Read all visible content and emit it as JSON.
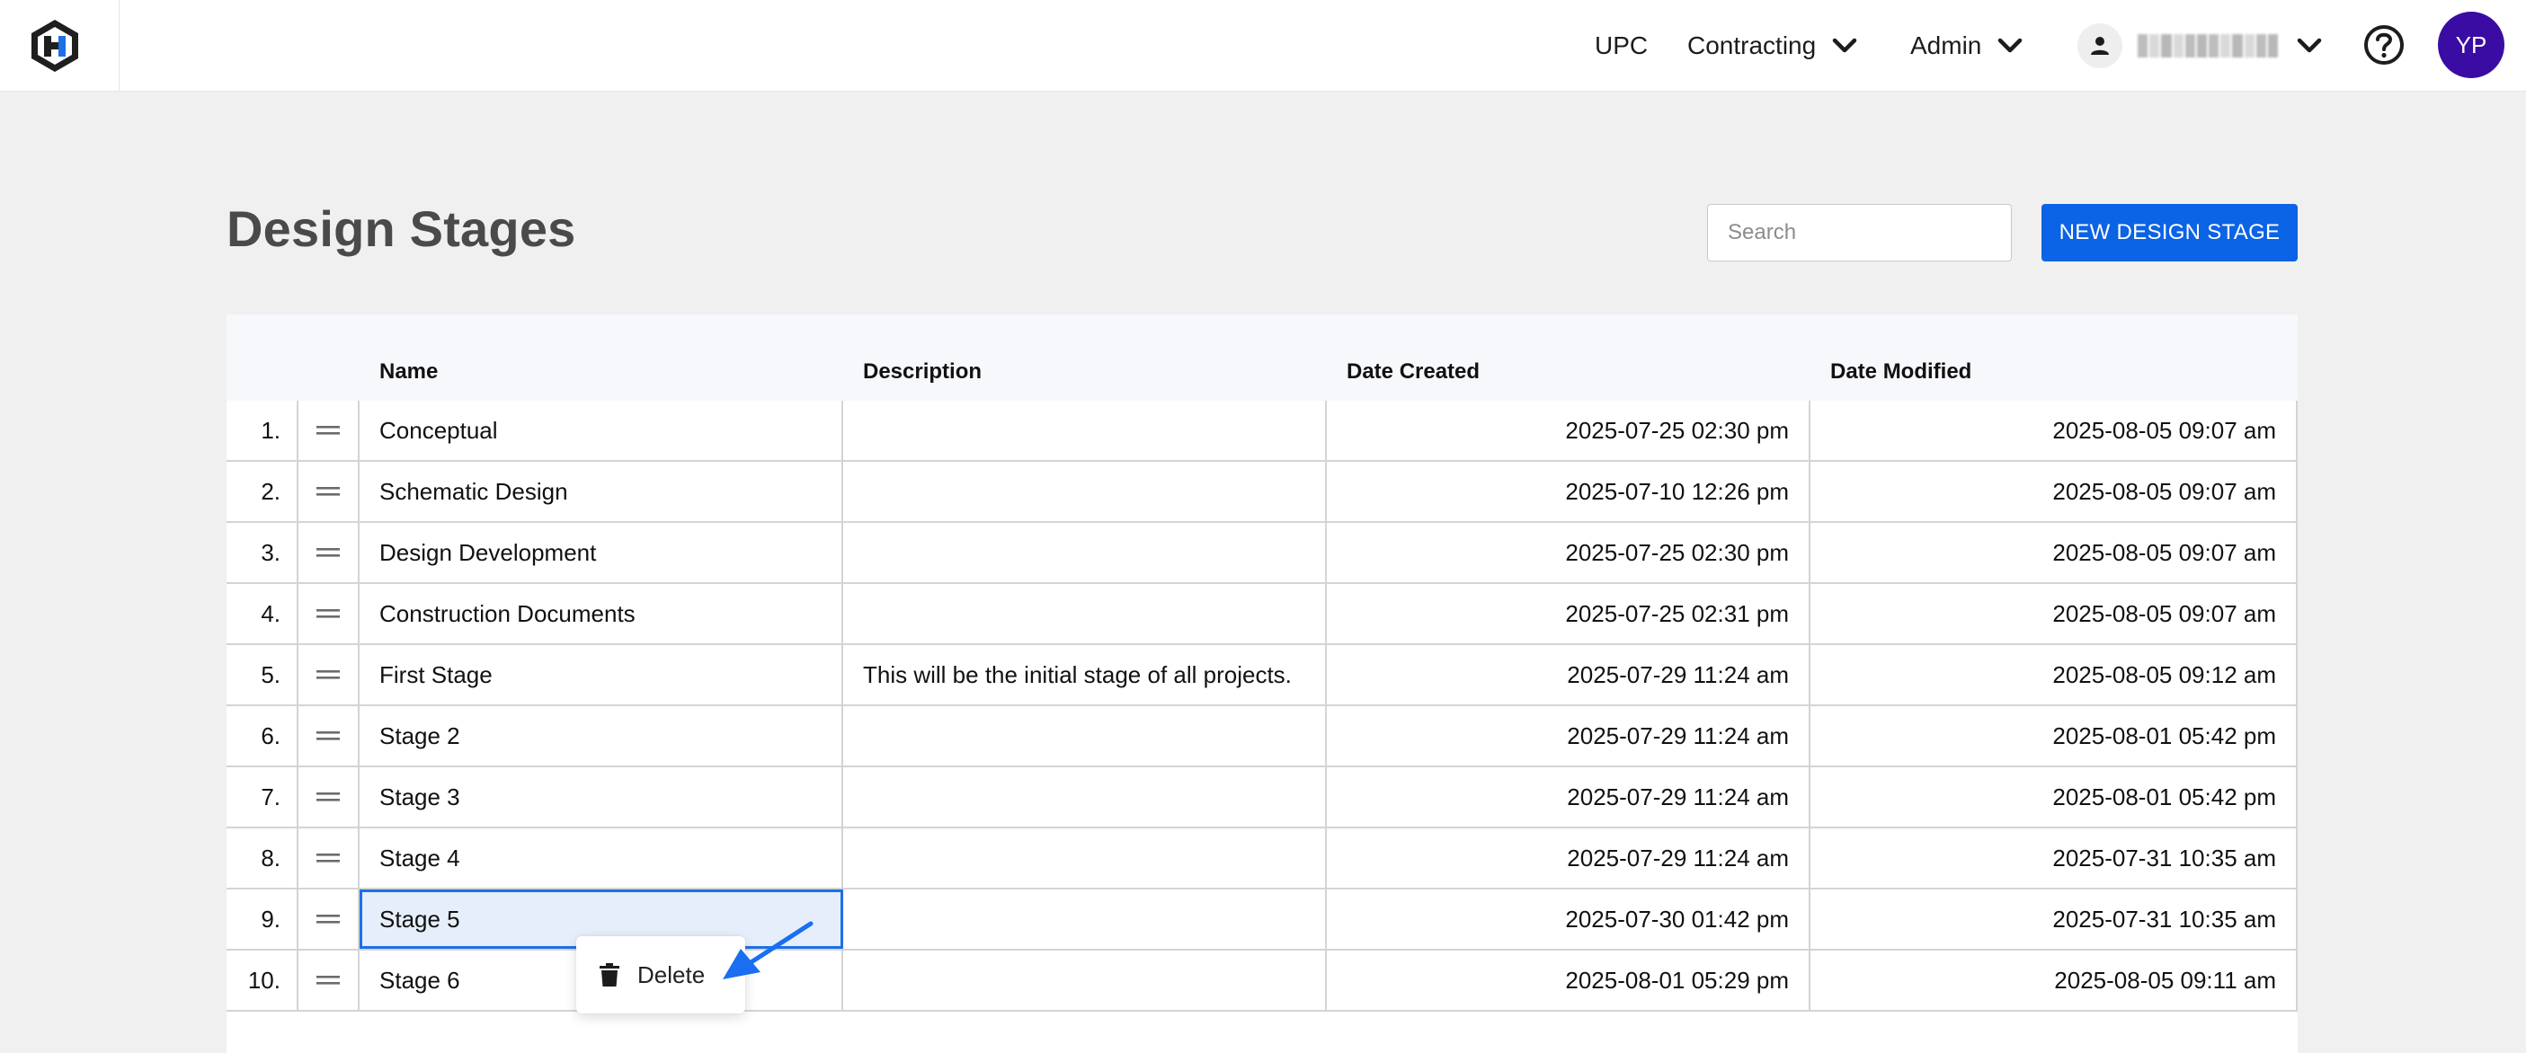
{
  "header": {
    "nav": [
      {
        "label": "UPC"
      },
      {
        "label": "Contracting"
      },
      {
        "label": "Admin"
      }
    ],
    "avatar_initials": "YP"
  },
  "page": {
    "title": "Design Stages",
    "search_placeholder": "Search",
    "new_button_label": "NEW DESIGN STAGE"
  },
  "table": {
    "columns": {
      "name": "Name",
      "description": "Description",
      "date_created": "Date Created",
      "date_modified": "Date Modified"
    },
    "rows": [
      {
        "num": "1.",
        "name": "Conceptual",
        "description": "",
        "created": "2025-07-25 02:30 pm",
        "modified": "2025-08-05 09:07 am"
      },
      {
        "num": "2.",
        "name": "Schematic Design",
        "description": "",
        "created": "2025-07-10 12:26 pm",
        "modified": "2025-08-05 09:07 am"
      },
      {
        "num": "3.",
        "name": "Design Development",
        "description": "",
        "created": "2025-07-25 02:30 pm",
        "modified": "2025-08-05 09:07 am"
      },
      {
        "num": "4.",
        "name": "Construction Documents",
        "description": "",
        "created": "2025-07-25 02:31 pm",
        "modified": "2025-08-05 09:07 am"
      },
      {
        "num": "5.",
        "name": "First Stage",
        "description": "This will be the initial stage of all projects.",
        "created": "2025-07-29 11:24 am",
        "modified": "2025-08-05 09:12 am"
      },
      {
        "num": "6.",
        "name": "Stage 2",
        "description": "",
        "created": "2025-07-29 11:24 am",
        "modified": "2025-08-01 05:42 pm"
      },
      {
        "num": "7.",
        "name": "Stage 3",
        "description": "",
        "created": "2025-07-29 11:24 am",
        "modified": "2025-08-01 05:42 pm"
      },
      {
        "num": "8.",
        "name": "Stage 4",
        "description": "",
        "created": "2025-07-29 11:24 am",
        "modified": "2025-07-31 10:35 am"
      },
      {
        "num": "9.",
        "name": "Stage 5",
        "description": "",
        "created": "2025-07-30 01:42 pm",
        "modified": "2025-07-31 10:35 am"
      },
      {
        "num": "10.",
        "name": "Stage 6",
        "description": "",
        "created": "2025-08-01 05:29 pm",
        "modified": "2025-08-05 09:11 am"
      }
    ],
    "selected_row": 8
  },
  "context_menu": {
    "delete_label": "Delete"
  },
  "colors": {
    "primary": "#0b63e5",
    "avatar_bg": "#3a0ca3",
    "selection_border": "#1f6fe6",
    "selection_bg": "#e6eefb",
    "annotation_arrow": "#1a6ef0"
  }
}
